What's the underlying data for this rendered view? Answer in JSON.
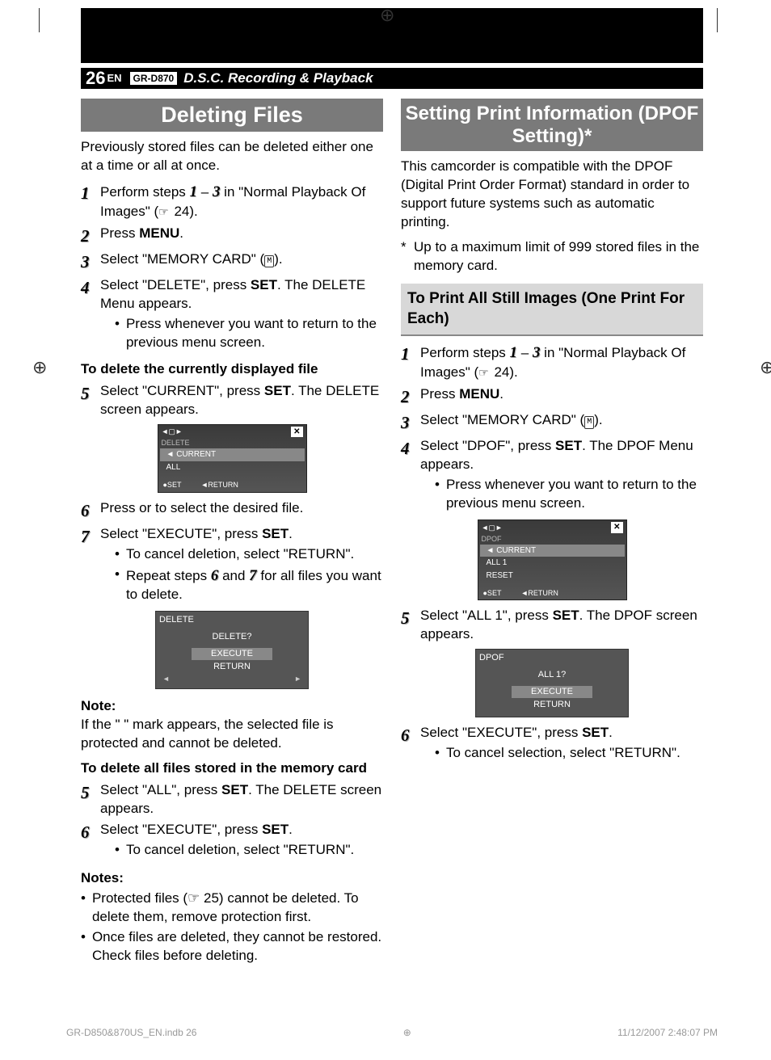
{
  "header": {
    "page_num": "26",
    "lang": "EN",
    "model": "GR-D870",
    "section": "D.S.C. Recording & Playback"
  },
  "left": {
    "title": "Deleting Files",
    "intro": "Previously stored files can be deleted either one at a time or all at once.",
    "step1_a": "Perform steps ",
    "step1_b": " – ",
    "step1_c": " in \"Normal Playback Of Images\" (",
    "step1_d": " 24).",
    "num1": "1",
    "num3": "3",
    "step2_a": "Press ",
    "step2_b": "MENU",
    "step2_c": ".",
    "step3": "Select \"MEMORY CARD\" (",
    "step3b": ").",
    "step4_a": "Select \"DELETE\", press ",
    "step4_b": "SET",
    "step4_c": ". The DELETE Menu appears.",
    "step4_bullet": "Press    whenever you want to return to the previous menu screen.",
    "sub1": "To delete the currently displayed file",
    "step5_a": "Select \"CURRENT\", press ",
    "step5_b": "SET",
    "step5_c": ". The DELETE screen appears.",
    "screen1": {
      "title": "DELETE",
      "row1": "CURRENT",
      "row2": "ALL",
      "set": "●SET",
      "ret": "◄RETURN",
      "x": "✕"
    },
    "step6": "Press    or    to select the desired file.",
    "step7_a": "Select \"EXECUTE\", press ",
    "step7_b": "SET",
    "step7_c": ".",
    "step7_bul1": "To cancel deletion, select \"RETURN\".",
    "step7_bul2a": "Repeat steps ",
    "step7_bul2b": " and ",
    "step7_bul2c": " for all files you want to delete.",
    "num6": "6",
    "num7": "7",
    "screen2": {
      "title": "DELETE",
      "q": "DELETE?",
      "exec": "EXECUTE",
      "ret": "RETURN"
    },
    "note_h": "Note:",
    "note1": "If the \"   \" mark appears, the selected file is protected and cannot be deleted.",
    "sub2": "To delete all files stored in the memory card",
    "step5b_a": "Select \"ALL\", press ",
    "step5b_b": "SET",
    "step5b_c": ". The DELETE screen appears.",
    "step6b_a": "Select \"EXECUTE\", press ",
    "step6b_b": "SET",
    "step6b_c": ".",
    "step6b_bul": "To cancel deletion, select \"RETURN\".",
    "notes_h": "Notes:",
    "notes_bul1": "Protected files (☞ 25) cannot be deleted. To delete them, remove protection first.",
    "notes_bul2": "Once files are deleted, they cannot be restored. Check files before deleting."
  },
  "right": {
    "title": "Setting Print Information (DPOF Setting)*",
    "intro": "This camcorder is compatible with the DPOF (Digital Print Order Format) standard in order to support future systems such as automatic printing.",
    "star": "*",
    "footnote": "Up to a maximum limit of 999 stored files in the memory card.",
    "sub": "To Print All Still Images (One Print For Each)",
    "step1_a": "Perform steps ",
    "step1_b": " – ",
    "step1_c": " in \"Normal Playback Of Images\" (",
    "step1_d": " 24).",
    "step2_a": "Press ",
    "step2_b": "MENU",
    "step2_c": ".",
    "step3": "Select \"MEMORY CARD\" (",
    "step3b": ").",
    "step4_a": "Select \"DPOF\", press ",
    "step4_b": "SET",
    "step4_c": ". The DPOF Menu appears.",
    "step4_bul": "Press    whenever you want to return to the previous menu screen.",
    "screen1": {
      "title": "DPOF",
      "row1": "CURRENT",
      "row2": "ALL 1",
      "row3": "RESET",
      "set": "●SET",
      "ret": "◄RETURN",
      "x": "✕"
    },
    "step5_a": "Select \"ALL 1\", press ",
    "step5_b": "SET",
    "step5_c": ". The DPOF screen appears.",
    "screen2": {
      "title": "DPOF",
      "q": "ALL 1?",
      "exec": "EXECUTE",
      "ret": "RETURN"
    },
    "step6_a": "Select \"EXECUTE\", press ",
    "step6_b": "SET",
    "step6_c": ".",
    "step6_bul": "To cancel selection, select \"RETURN\"."
  },
  "footer": {
    "file": "GR-D850&870US_EN.indb   26",
    "date": "11/12/2007   2:48:07 PM"
  }
}
